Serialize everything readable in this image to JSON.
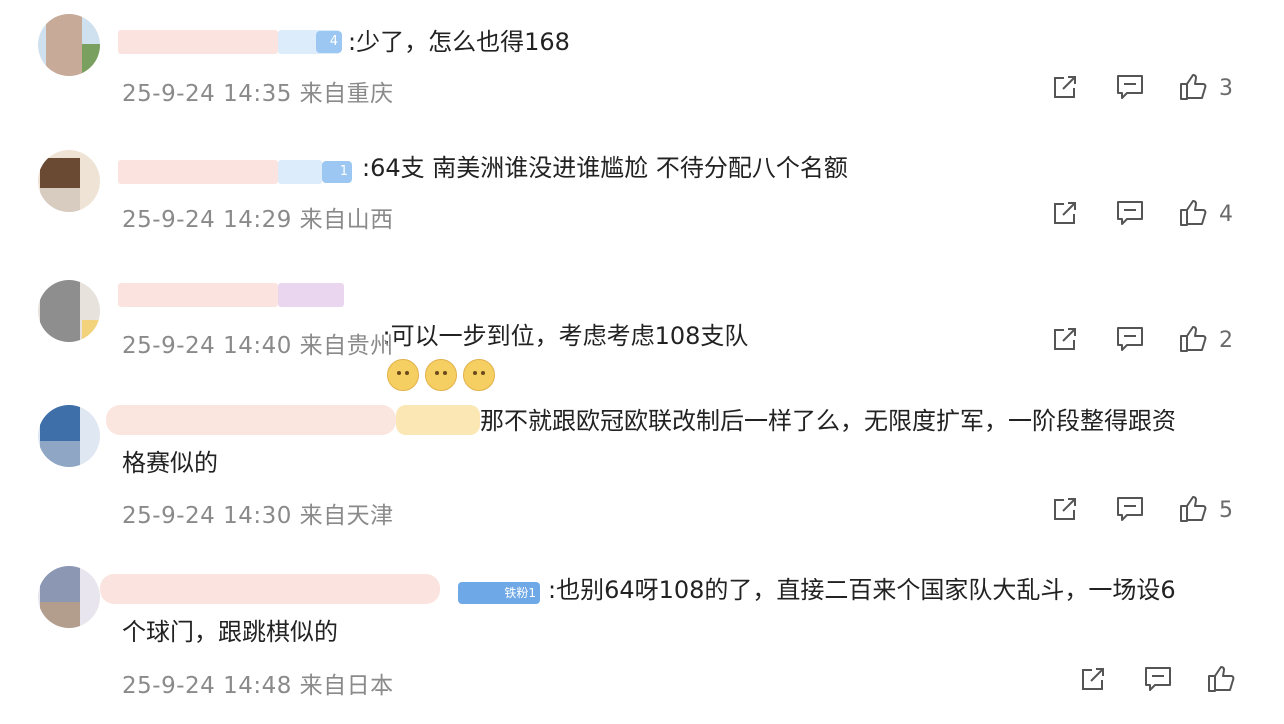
{
  "comments": [
    {
      "text": ":少了，怎么也得168",
      "time": "25-9-24 14:35",
      "location": "来自重庆",
      "likes": "3"
    },
    {
      "text": ":64支 南美洲谁没进谁尴尬 不待分配八个名额",
      "time": "25-9-24 14:29",
      "location": "来自山西",
      "likes": "4"
    },
    {
      "text": ":可以一步到位，考虑考虑108支队",
      "time": "25-9-24 14:40",
      "location": "来自贵州",
      "likes": "2",
      "emoji_count": 3
    },
    {
      "text": "那不就跟欧冠欧联改制后一样了么，无限度扩军，一阶段整得跟资\n格赛似的",
      "time": "25-9-24 14:30",
      "location": "来自天津",
      "likes": "5"
    },
    {
      "text": ":也别64呀108的了，直接二百来个国家队大乱斗，一场设6\n个球门，跟跳棋似的",
      "time": "25-9-24 14:48",
      "location": "来自日本",
      "likes": ""
    }
  ],
  "badges": [
    "4",
    "1",
    "",
    "",
    "铁粉1"
  ],
  "icons": {
    "share": "share-icon",
    "reply": "comment-icon",
    "like": "thumbs-up-icon"
  }
}
